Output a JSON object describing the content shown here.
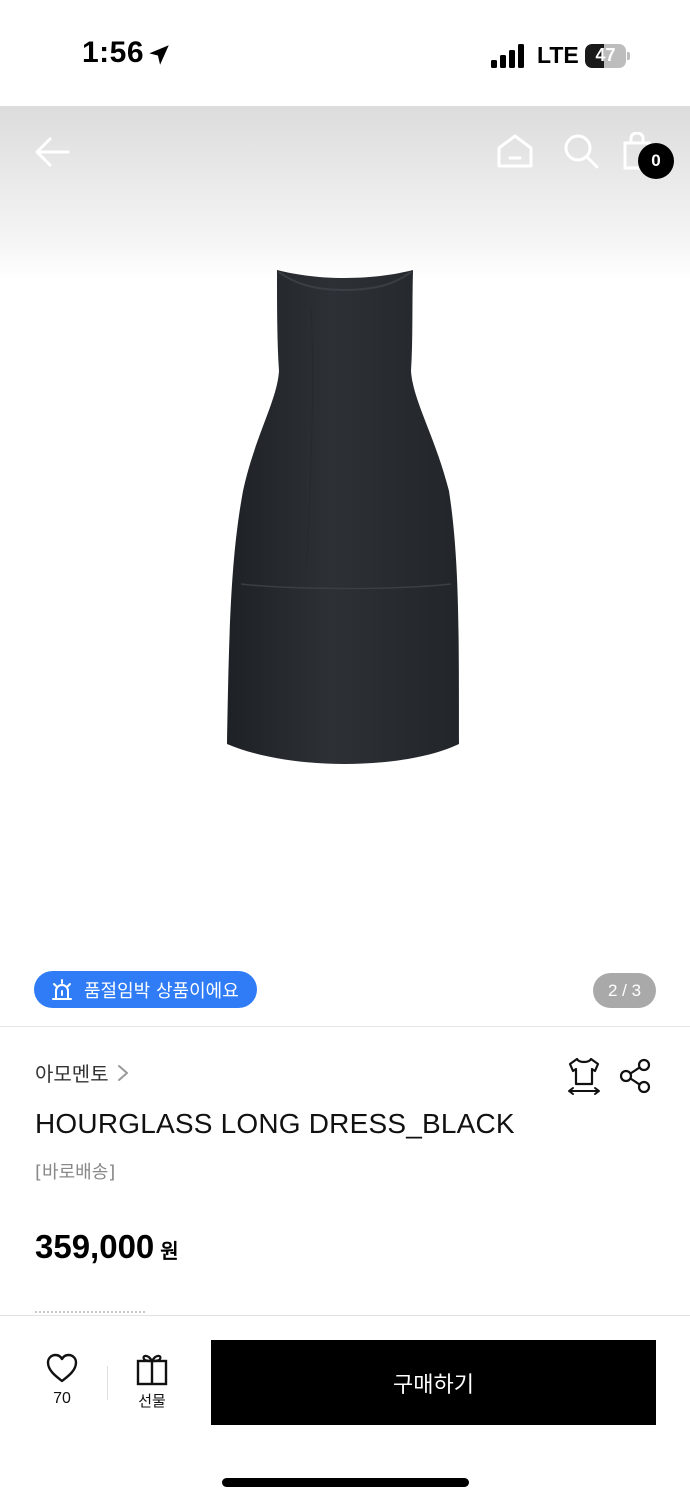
{
  "status_bar": {
    "time": "1:56",
    "network": "LTE",
    "battery_level": "47",
    "battery_fraction": 0.47
  },
  "nav": {
    "back_icon": "arrow-left-icon",
    "home_icon": "home-icon",
    "search_icon": "search-icon",
    "cart_icon": "shopping-bag-icon",
    "cart_count": "0"
  },
  "gallery": {
    "alert_icon": "siren-icon",
    "alert_text": "품절임박 상품이에요",
    "page_indicator": "2 / 3",
    "alert_color": "#2f7cf6"
  },
  "product": {
    "brand": "아모멘토",
    "name": "HOURGLASS LONG DRESS_BLACK",
    "shipping_tag": "[바로배송]",
    "price": "359,000",
    "currency": "원",
    "size_icon": "size-guide-icon",
    "share_icon": "share-icon"
  },
  "bottom_bar": {
    "like_icon": "heart-icon",
    "like_count": "70",
    "gift_icon": "gift-icon",
    "gift_label": "선물",
    "buy_label": "구매하기"
  }
}
